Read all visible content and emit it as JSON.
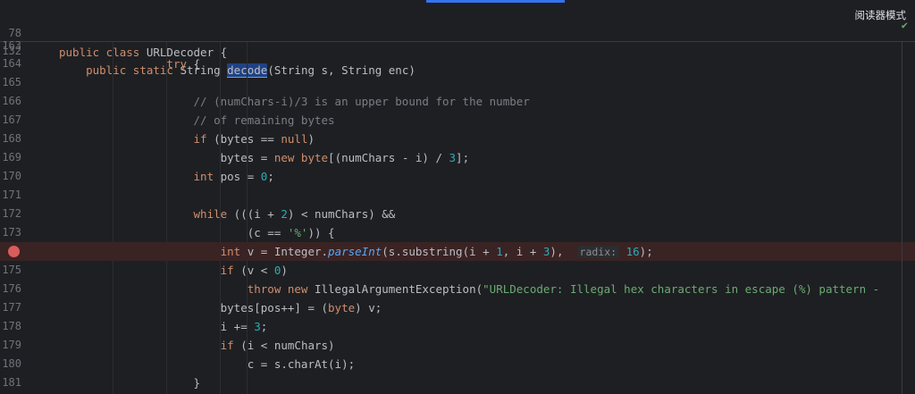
{
  "reader_mode": "阅读器模式",
  "sticky": [
    {
      "ln": "78",
      "parts": [
        [
          "kw",
          "public class "
        ],
        [
          "",
          "URLDecoder {"
        ]
      ]
    },
    {
      "ln": "132",
      "parts": [
        [
          "",
          "    "
        ],
        [
          "kw",
          "public static "
        ],
        [
          "",
          "String "
        ],
        [
          "sel",
          "decode"
        ],
        [
          "",
          "(String s, String enc)"
        ]
      ]
    }
  ],
  "lines": [
    {
      "ln": "163",
      "parts": []
    },
    {
      "ln": "164",
      "parts": [
        [
          "",
          "                "
        ],
        [
          "kw",
          "try"
        ],
        [
          "",
          " {"
        ]
      ]
    },
    {
      "ln": "165",
      "parts": []
    },
    {
      "ln": "166",
      "parts": [
        [
          "",
          "                    "
        ],
        [
          "cmt",
          "// (numChars-i)/3 is an upper bound for the number"
        ]
      ]
    },
    {
      "ln": "167",
      "parts": [
        [
          "",
          "                    "
        ],
        [
          "cmt",
          "// of remaining bytes"
        ]
      ]
    },
    {
      "ln": "168",
      "parts": [
        [
          "",
          "                    "
        ],
        [
          "kw",
          "if"
        ],
        [
          "",
          " (bytes == "
        ],
        [
          "kw",
          "null"
        ],
        [
          "",
          ")"
        ]
      ]
    },
    {
      "ln": "169",
      "parts": [
        [
          "",
          "                        bytes = "
        ],
        [
          "kw",
          "new byte"
        ],
        [
          "",
          "[(numChars - i) / "
        ],
        [
          "num",
          "3"
        ],
        [
          "",
          "];"
        ]
      ]
    },
    {
      "ln": "170",
      "parts": [
        [
          "",
          "                    "
        ],
        [
          "kw",
          "int"
        ],
        [
          "",
          " pos = "
        ],
        [
          "num",
          "0"
        ],
        [
          "",
          ";"
        ]
      ]
    },
    {
      "ln": "171",
      "parts": []
    },
    {
      "ln": "172",
      "parts": [
        [
          "",
          "                    "
        ],
        [
          "kw",
          "while"
        ],
        [
          "",
          " (((i + "
        ],
        [
          "num",
          "2"
        ],
        [
          "",
          ") < numChars) &&"
        ]
      ]
    },
    {
      "ln": "173",
      "parts": [
        [
          "",
          "                            (c == "
        ],
        [
          "str",
          "'%'"
        ],
        [
          "",
          ")) {"
        ]
      ]
    },
    {
      "ln": "174",
      "bp": true,
      "parts": [
        [
          "",
          "                        "
        ],
        [
          "kw",
          "int"
        ],
        [
          "",
          " v = Integer."
        ],
        [
          "fn-italic",
          "parseInt"
        ],
        [
          "",
          "(s.substring(i + "
        ],
        [
          "num",
          "1"
        ],
        [
          "",
          ", i + "
        ],
        [
          "num",
          "3"
        ],
        [
          "",
          "),  "
        ],
        [
          "hint",
          "radix:"
        ],
        [
          "",
          " "
        ],
        [
          "num",
          "16"
        ],
        [
          "",
          ");"
        ]
      ]
    },
    {
      "ln": "175",
      "parts": [
        [
          "",
          "                        "
        ],
        [
          "kw",
          "if"
        ],
        [
          "",
          " (v < "
        ],
        [
          "num",
          "0"
        ],
        [
          "",
          ")"
        ]
      ]
    },
    {
      "ln": "176",
      "parts": [
        [
          "",
          "                            "
        ],
        [
          "kw",
          "throw new "
        ],
        [
          "",
          "IllegalArgumentException("
        ],
        [
          "str",
          "\"URLDecoder: Illegal hex characters in escape (%) pattern - "
        ]
      ]
    },
    {
      "ln": "177",
      "parts": [
        [
          "",
          "                        bytes[pos++] = ("
        ],
        [
          "kw",
          "byte"
        ],
        [
          "",
          ") v;"
        ]
      ]
    },
    {
      "ln": "178",
      "parts": [
        [
          "",
          "                        i += "
        ],
        [
          "num",
          "3"
        ],
        [
          "",
          ";"
        ]
      ]
    },
    {
      "ln": "179",
      "parts": [
        [
          "",
          "                        "
        ],
        [
          "kw",
          "if"
        ],
        [
          "",
          " (i < numChars)"
        ]
      ]
    },
    {
      "ln": "180",
      "parts": [
        [
          "",
          "                            c = s.charAt(i);"
        ]
      ]
    },
    {
      "ln": "181",
      "parts": [
        [
          "",
          "                    }"
        ]
      ]
    }
  ]
}
